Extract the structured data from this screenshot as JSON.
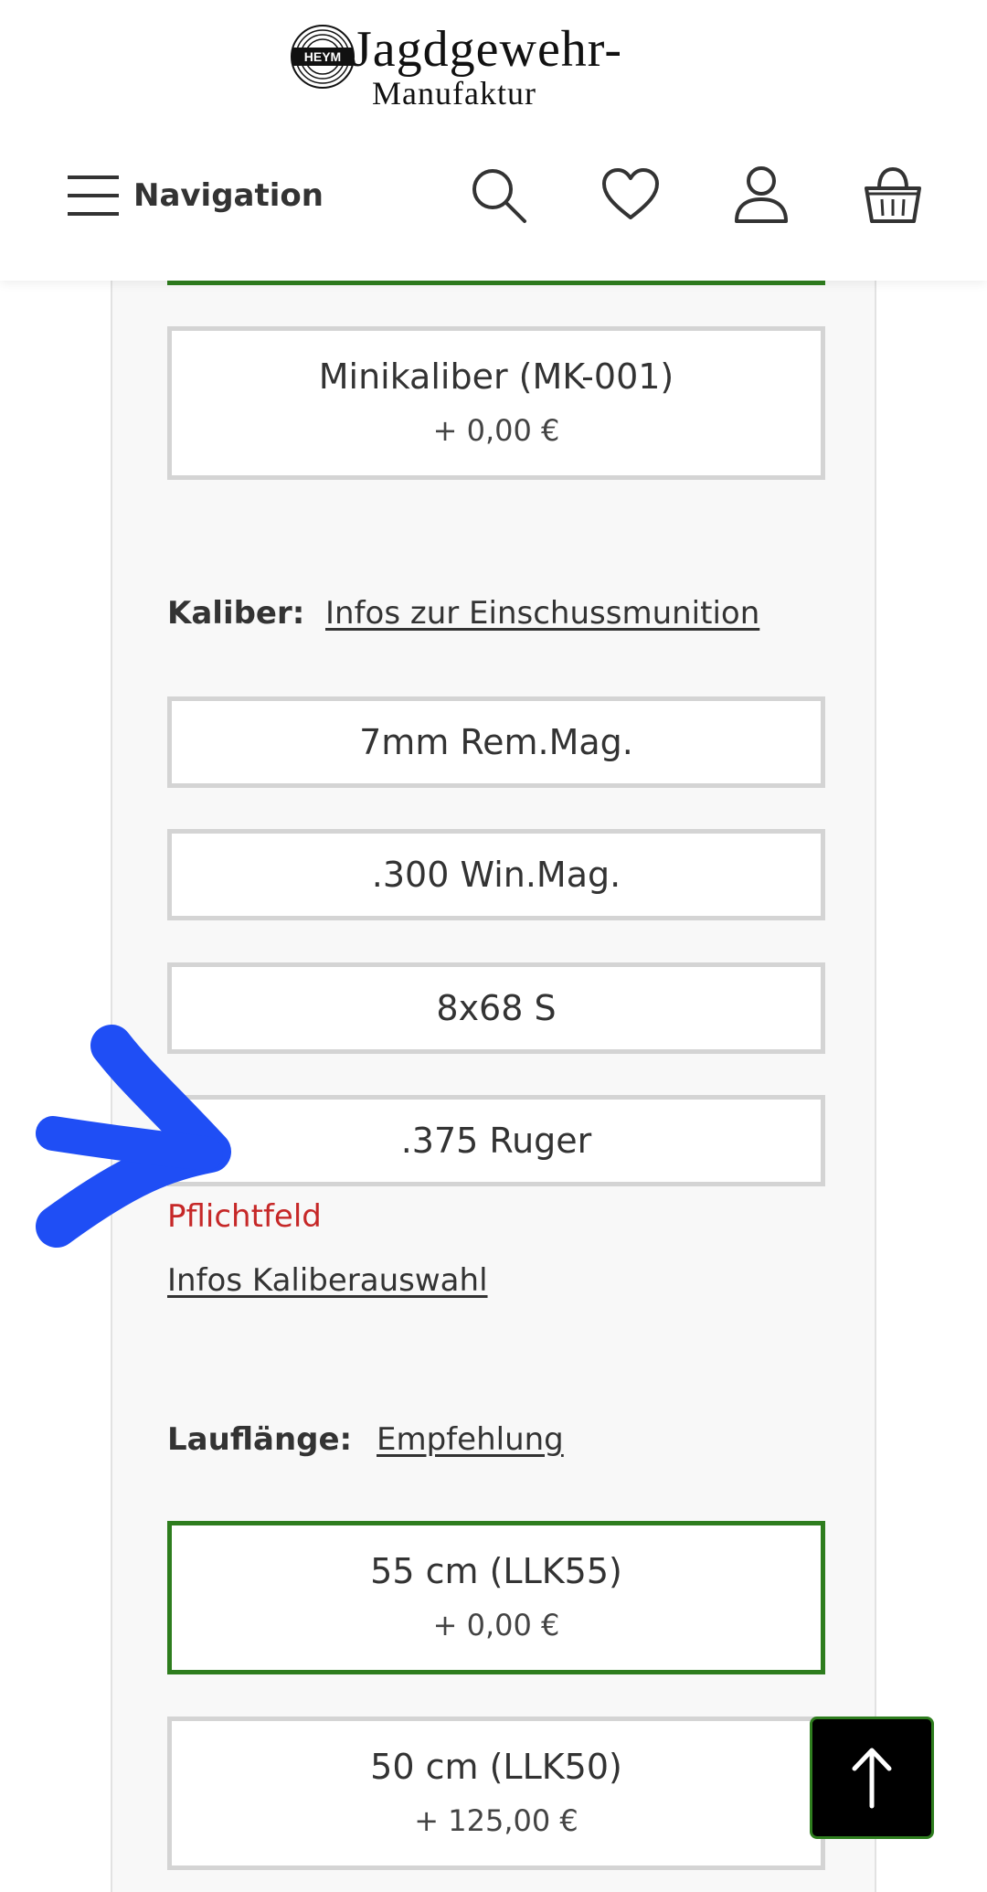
{
  "header": {
    "logo": {
      "emblem_text": "HEYM",
      "line1": "Jagdgewehr-",
      "line2": "Manufaktur"
    },
    "nav_label": "Navigation",
    "icons": [
      "search-icon",
      "heart-icon",
      "user-icon",
      "basket-icon"
    ]
  },
  "options_top": [
    {
      "name": "Minikaliber (MK-001)",
      "price": "+ 0,00 €"
    }
  ],
  "kaliber": {
    "label": "Kaliber:",
    "link": "Infos zur Einschussmunition",
    "options": [
      {
        "name": "7mm Rem.Mag."
      },
      {
        "name": ".300 Win.Mag."
      },
      {
        "name": "8x68 S"
      },
      {
        "name": ".375 Ruger"
      }
    ],
    "error": "Pflichtfeld",
    "info_link": "Infos Kaliberauswahl"
  },
  "lauflaenge": {
    "label": "Lauflänge:",
    "link": "Empfehlung",
    "options": [
      {
        "name": "55 cm (LLK55)",
        "price": "+ 0,00 €",
        "selected": true
      },
      {
        "name": "50 cm (LLK50)",
        "price": "+ 125,00 €",
        "selected": false
      }
    ]
  },
  "colors": {
    "accent_green": "#2e7d1e",
    "error_red": "#c62828",
    "annotation_blue": "#1f4ef5"
  }
}
